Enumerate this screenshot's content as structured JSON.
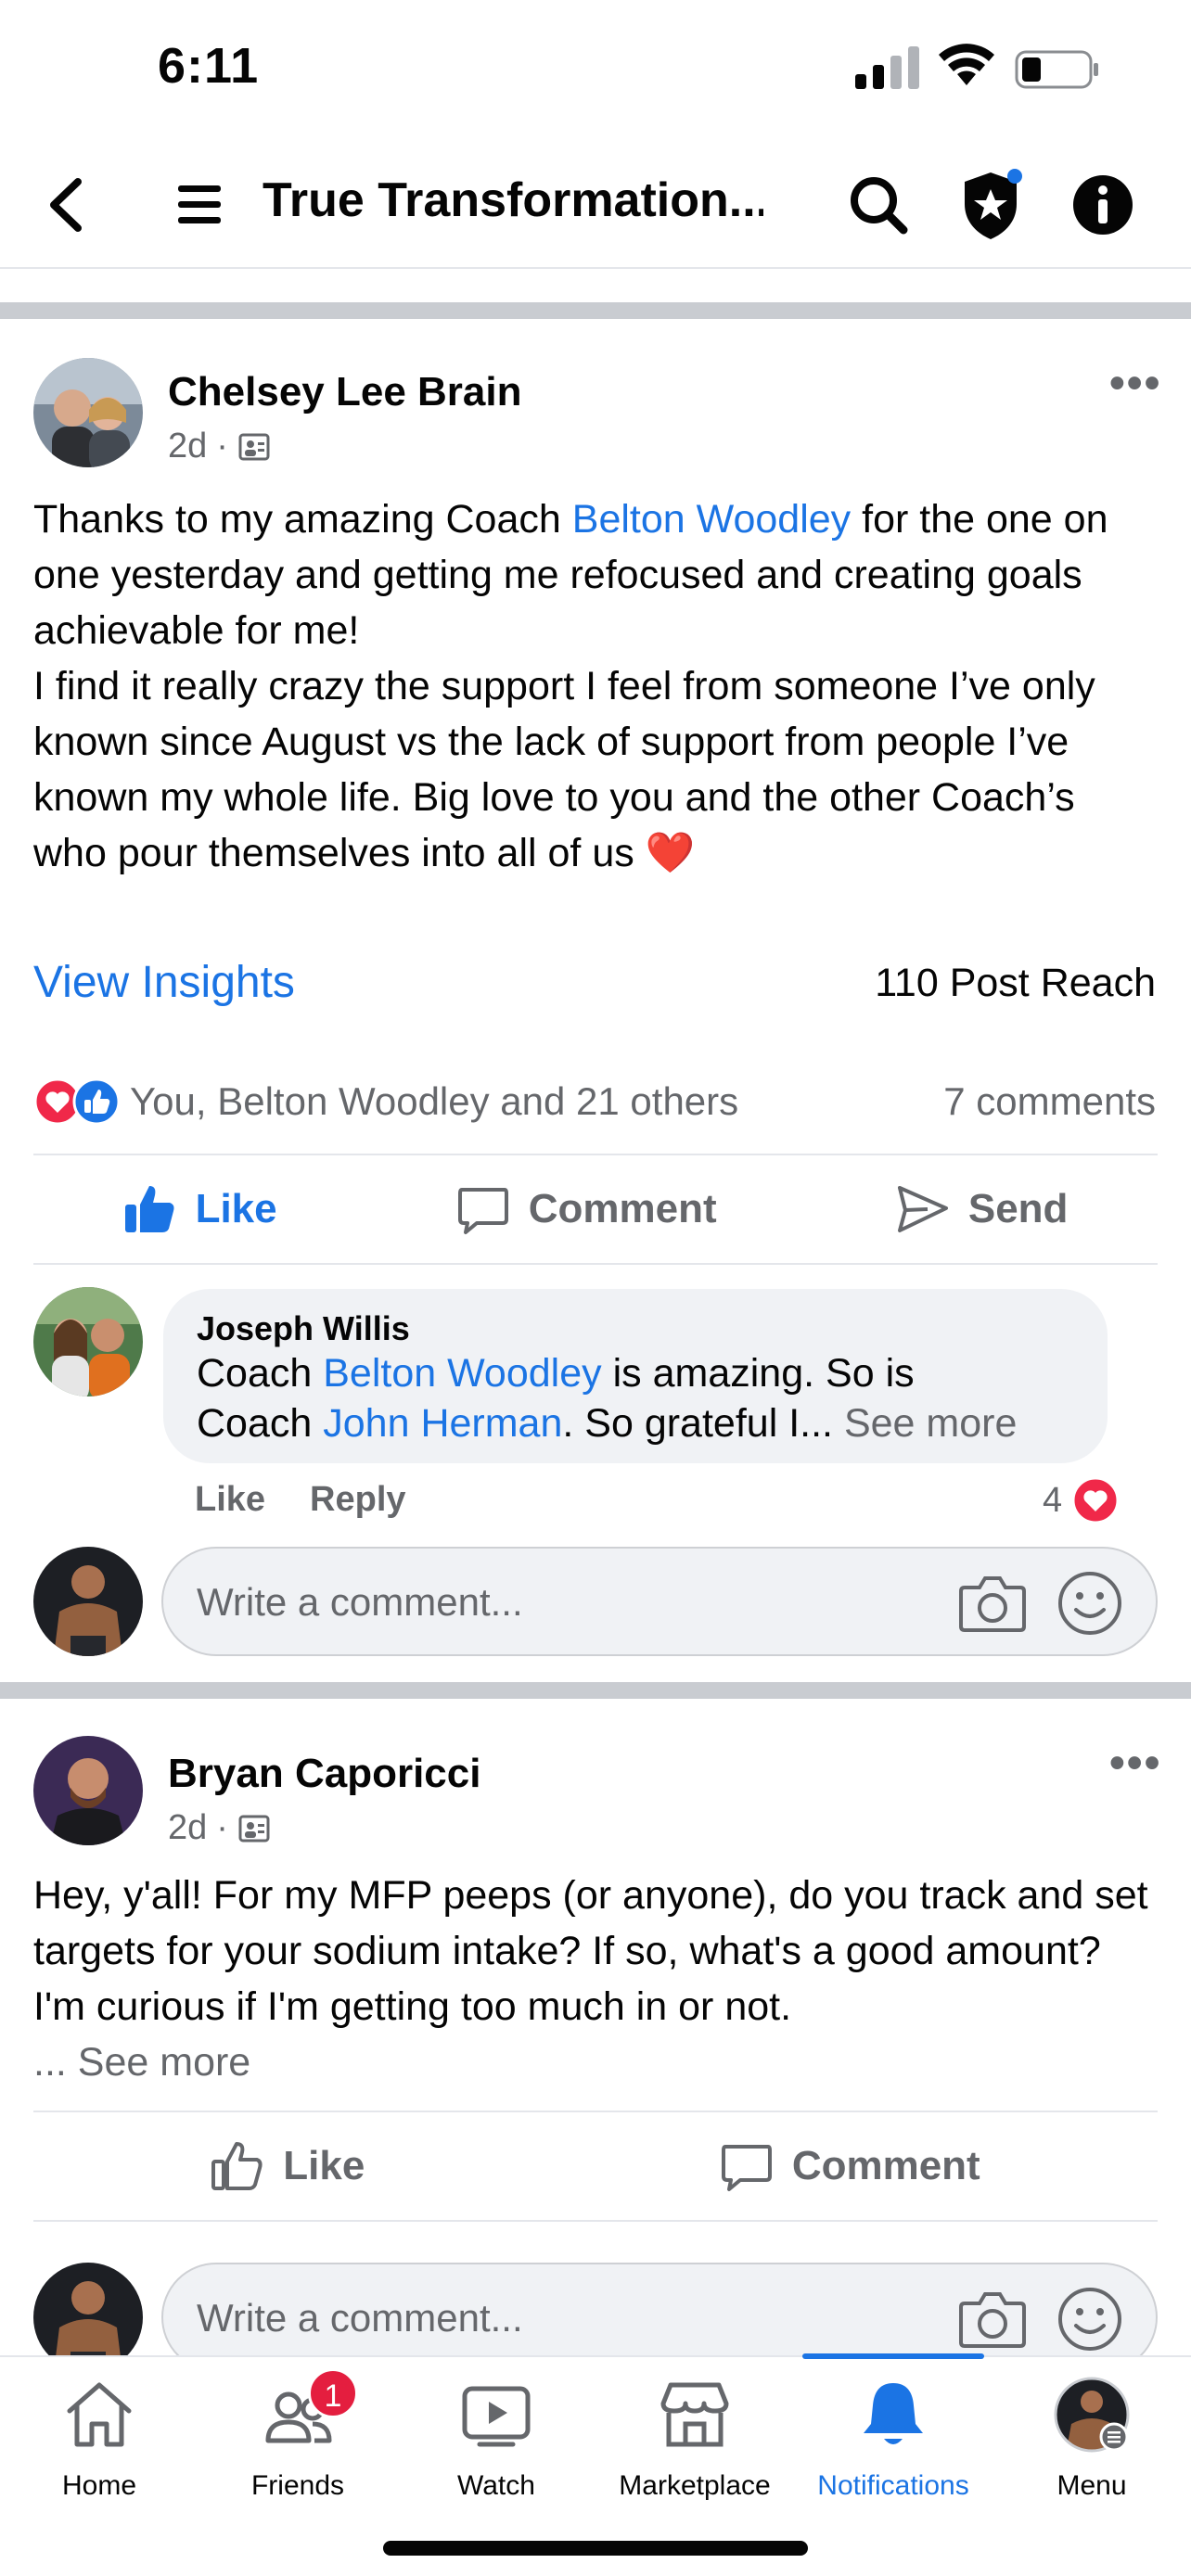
{
  "status_bar": {
    "time": "6:11"
  },
  "header": {
    "title": "True Transformation..."
  },
  "posts": [
    {
      "author": "Chelsey Lee Brain",
      "time": "2d",
      "text_segments": [
        "Thanks to my amazing Coach ",
        "Belton Woodley",
        " for the one on one yesterday and getting me refocused and creating goals achievable for me!",
        "I find it really crazy the support I feel from someone I’ve only known since August vs the lack of support from people I’ve known my whole life. Big love to you and the other Coach’s who pour themselves into all of us ❤️"
      ],
      "view_insights": "View Insights",
      "post_reach": "110 Post Reach",
      "reactions_text": "You, Belton Woodley and 21 others",
      "comments_count": "7 comments",
      "actions": {
        "like": "Like",
        "comment": "Comment",
        "send": "Send"
      },
      "top_comment": {
        "author": "Joseph Willis",
        "seg1": "Coach ",
        "mention1": "Belton Woodley",
        "seg2": " is amazing.  So is",
        "seg3": "Coach ",
        "mention2": "John Herman",
        "seg4": ".  So grateful I... ",
        "see_more": "See more",
        "like": "Like",
        "reply": "Reply",
        "reaction_count": "4"
      },
      "write_comment_placeholder": "Write a comment..."
    },
    {
      "author": "Bryan Caporicci",
      "time": "2d",
      "text": "Hey, y'all! For my MFP peeps (or anyone), do you track and set targets for your sodium intake? If so, what's a good amount? I'm curious if I'm getting too much in or not.",
      "see_more": "... See more",
      "actions": {
        "like": "Like",
        "comment": "Comment"
      },
      "write_comment_placeholder": "Write a comment..."
    }
  ],
  "tabs": [
    {
      "label": "Home",
      "icon": "home-icon"
    },
    {
      "label": "Friends",
      "icon": "friends-icon",
      "badge": "1"
    },
    {
      "label": "Watch",
      "icon": "watch-icon"
    },
    {
      "label": "Marketplace",
      "icon": "marketplace-icon"
    },
    {
      "label": "Notifications",
      "icon": "bell-icon",
      "active": true
    },
    {
      "label": "Menu",
      "icon": "avatar"
    }
  ],
  "colors": {
    "accent": "#1b74e4",
    "text": "#050505",
    "muted": "#65676b",
    "badge": "#e41e3f",
    "love": "#f02849"
  }
}
